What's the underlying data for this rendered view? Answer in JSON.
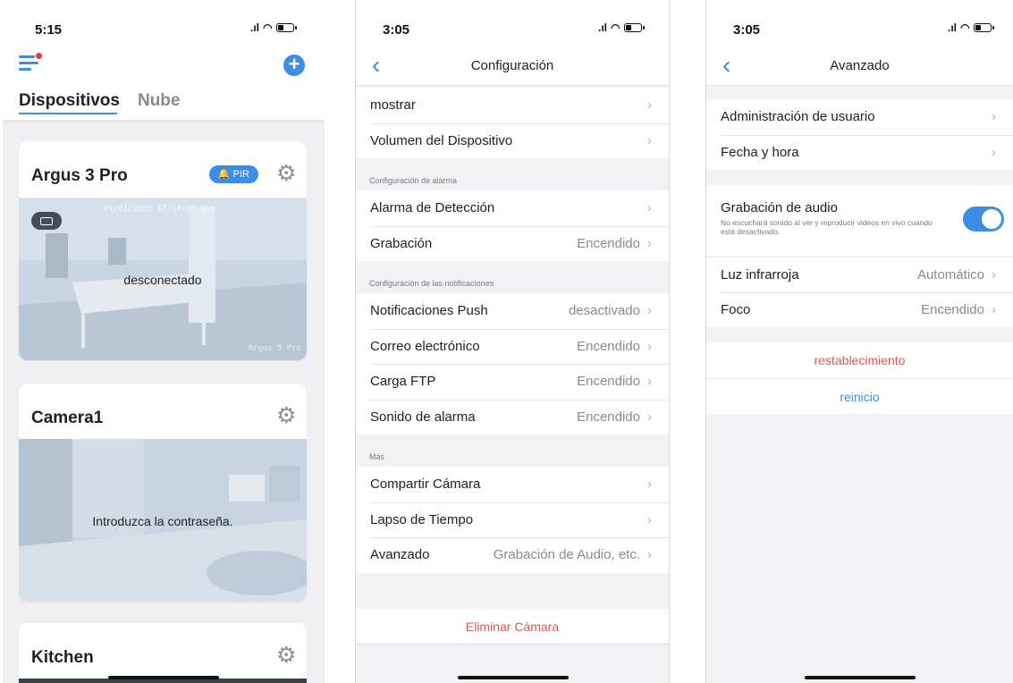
{
  "screen1": {
    "status_time": "5:15",
    "tabs": [
      "Dispositivos",
      "Nube"
    ],
    "devices": [
      {
        "name": "Argus 3 Pro",
        "badge": "PIR",
        "overlay": "desconectado",
        "watermark_top": "01/01/2020 17:14:03 Sat",
        "watermark_bottom": "Argus 3 Pro"
      },
      {
        "name": "Camera1",
        "overlay": "Introduzca la contraseña."
      },
      {
        "name": "Kitchen"
      }
    ]
  },
  "screen2": {
    "status_time": "3:05",
    "title": "Configuración",
    "group1": [
      {
        "label": "mostrar",
        "value": ""
      },
      {
        "label": "Volumen del Dispositivo",
        "value": ""
      }
    ],
    "section_alarm": "Configuración de alarma",
    "group_alarm": [
      {
        "label": "Alarma de Detección",
        "value": ""
      },
      {
        "label": "Grabación",
        "value": "Encendido"
      }
    ],
    "section_notif": "Configuración de las notificaciones",
    "group_notif": [
      {
        "label": "Notificaciones Push",
        "value": "desactivado"
      },
      {
        "label": "Correo electrónico",
        "value": "Encendido"
      },
      {
        "label": "Carga FTP",
        "value": "Encendido"
      },
      {
        "label": "Sonido de alarma",
        "value": "Encendido"
      }
    ],
    "section_more": "Más",
    "group_more": [
      {
        "label": "Compartir Cámara",
        "value": ""
      },
      {
        "label": "Lapso de Tiempo",
        "value": ""
      },
      {
        "label": "Avanzado",
        "value": "Grabación de Audio, etc."
      }
    ],
    "delete_label": "Eliminar Cámara"
  },
  "screen3": {
    "status_time": "3:05",
    "title": "Avanzado",
    "group1": [
      {
        "label": "Administración de usuario",
        "value": ""
      },
      {
        "label": "Fecha y hora",
        "value": ""
      }
    ],
    "audio": {
      "label": "Grabación de audio",
      "description": "No escuchará sonido al ver y reproducir videos en vivo cuando está desactivado.",
      "enabled": true
    },
    "group2": [
      {
        "label": "Luz infrarroja",
        "value": "Automático"
      },
      {
        "label": "Foco",
        "value": "Encendido"
      }
    ],
    "reset_label": "restablecimiento",
    "reboot_label": "reinicio"
  },
  "colors": {
    "accent": "#3a8ee6",
    "danger": "#e8534f",
    "background": "#f2f2f4"
  }
}
